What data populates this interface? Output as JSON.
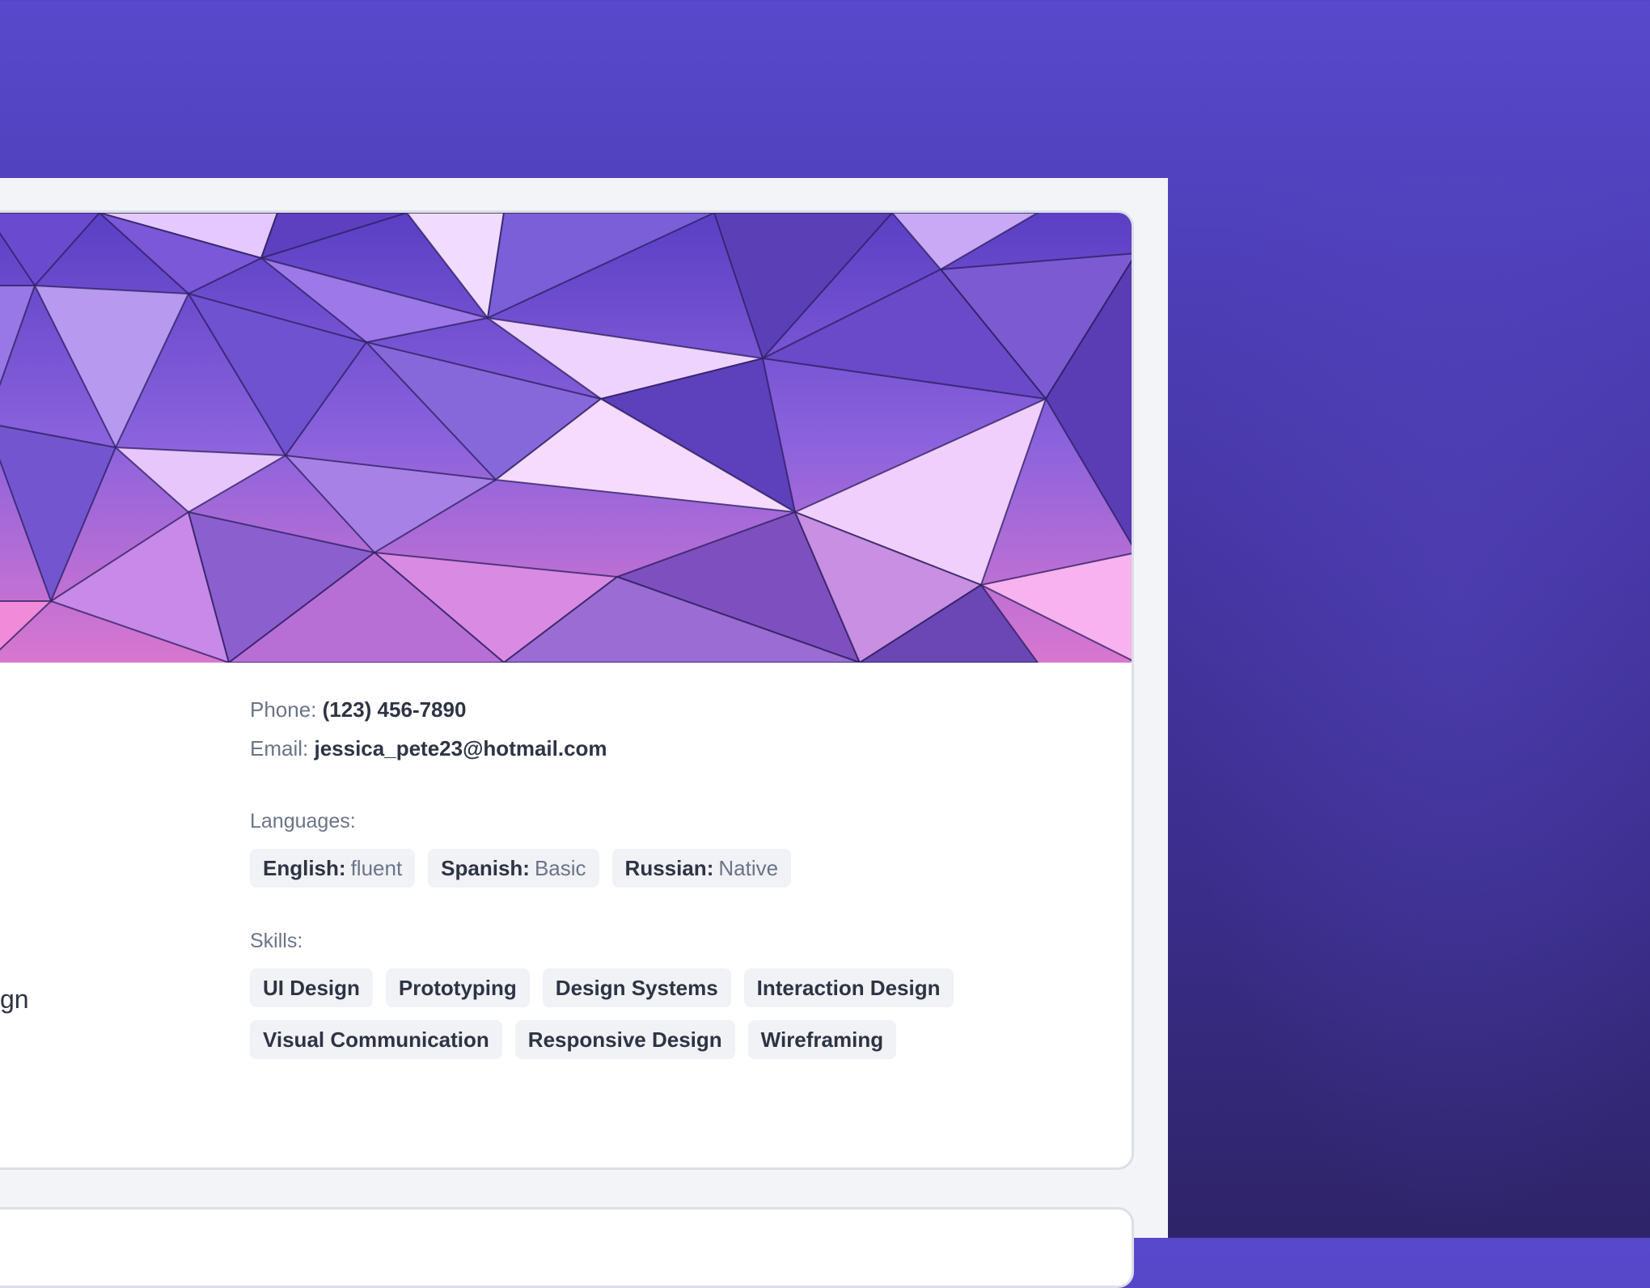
{
  "profile": {
    "phone_label": "Phone:",
    "phone_value": "(123) 456-7890",
    "email_label": "Email:",
    "email_value": "jessica_pete23@hotmail.com",
    "left_column_fragment": "gn"
  },
  "languages": {
    "label": "Languages:",
    "items": [
      {
        "name": "English:",
        "level": "fluent"
      },
      {
        "name": "Spanish:",
        "level": "Basic"
      },
      {
        "name": "Russian:",
        "level": "Native"
      }
    ]
  },
  "skills": {
    "label": "Skills:",
    "items": [
      "UI Design",
      "Prototyping",
      "Design Systems",
      "Interaction Design",
      "Visual Communication",
      "Responsive Design",
      "Wireframing"
    ]
  },
  "colors": {
    "background_top": "#5849cc",
    "background_bottom": "#2e2468",
    "panel": "#f3f4f8",
    "card": "#ffffff",
    "chip_bg": "#f0f2f6",
    "text_dark": "#2d3444",
    "text_muted": "#6b7488"
  }
}
